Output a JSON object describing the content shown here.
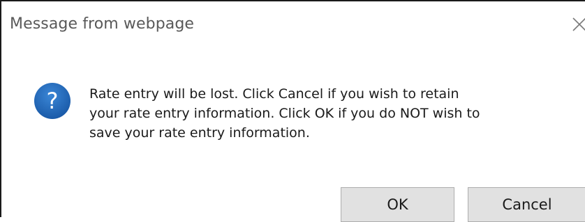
{
  "dialog": {
    "title": "Message from webpage",
    "icon": "question-icon",
    "message_lines": [
      "Rate entry will be lost. Click Cancel if you wish to retain",
      "your rate entry information. Click OK if you do NOT wish to",
      "save your rate entry information."
    ],
    "buttons": {
      "ok_label": "OK",
      "cancel_label": "Cancel"
    },
    "close_icon": "close-icon",
    "colors": {
      "icon_blue": "#1e64b4",
      "button_bg": "#e1e1e1",
      "title_text": "#595959"
    }
  }
}
